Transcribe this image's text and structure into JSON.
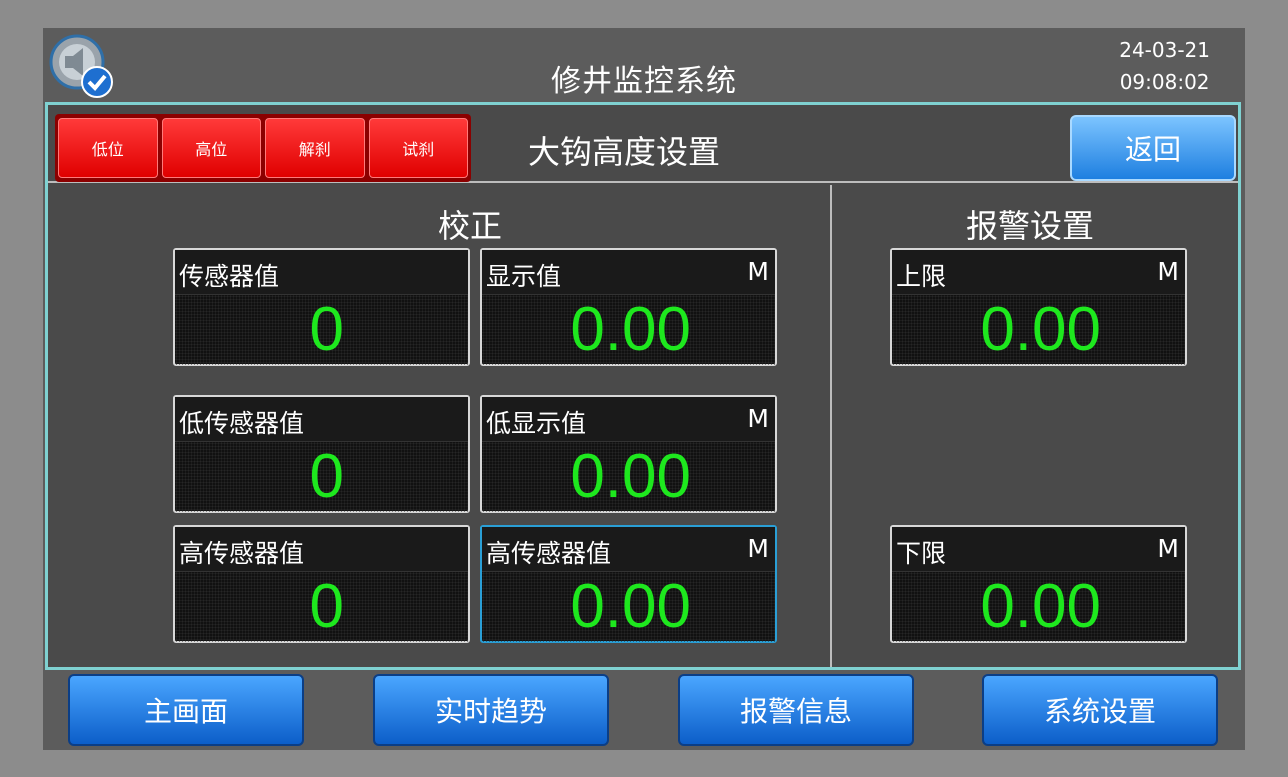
{
  "header": {
    "app_title": "修井监控系统",
    "date": "24-03-21",
    "time": "09:08:02",
    "logo_icon": "speaker-check-icon"
  },
  "topbar": {
    "status_buttons": [
      "低位",
      "高位",
      "解刹",
      "试刹"
    ],
    "screen_title": "大钩高度设置",
    "back_label": "返回"
  },
  "calibration": {
    "title": "校正",
    "sensor": {
      "label": "传感器值",
      "value": "0"
    },
    "display": {
      "label": "显示值",
      "unit": "M",
      "value": "0.00"
    },
    "low_sensor": {
      "label": "低传感器值",
      "value": "0"
    },
    "low_display": {
      "label": "低显示值",
      "unit": "M",
      "value": "0.00"
    },
    "high_sensor": {
      "label": "高传感器值",
      "value": "0"
    },
    "high_display": {
      "label": "高传感器值",
      "unit": "M",
      "value": "0.00"
    }
  },
  "alarm": {
    "title": "报警设置",
    "upper": {
      "label": "上限",
      "unit": "M",
      "value": "0.00"
    },
    "lower": {
      "label": "下限",
      "unit": "M",
      "value": "0.00"
    }
  },
  "nav": [
    "主画面",
    "实时趋势",
    "报警信息",
    "系统设置"
  ],
  "colors": {
    "value_green": "#1ee81e",
    "alarm_red": "#e00000",
    "button_blue": "#1e7fe0",
    "panel_border": "#7fd1d1"
  }
}
